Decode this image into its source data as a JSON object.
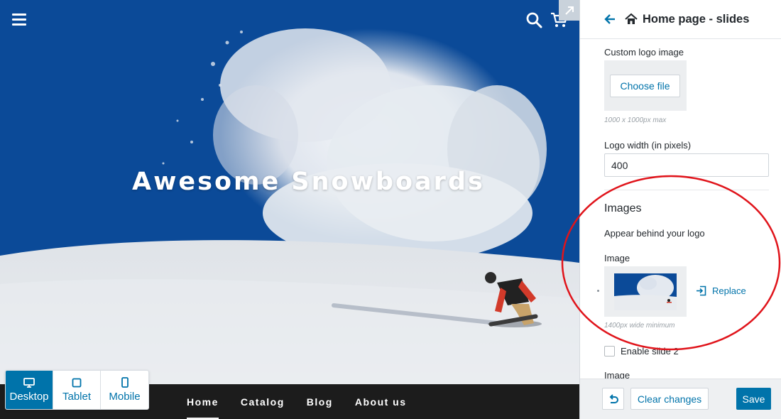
{
  "preview": {
    "hero_title": "Awesome Snowboards",
    "nav": [
      {
        "label": "Home",
        "active": true
      },
      {
        "label": "Catalog",
        "active": false
      },
      {
        "label": "Blog",
        "active": false
      },
      {
        "label": "About us",
        "active": false
      }
    ],
    "icons": {
      "menu": "hamburger-menu-icon",
      "search": "search-icon",
      "cart": "cart-icon",
      "expand": "expand-arrow-icon"
    }
  },
  "device_switcher": {
    "desktop": "Desktop",
    "tablet": "Tablet",
    "mobile": "Mobile",
    "active": "Desktop"
  },
  "panel": {
    "title": "Home page - slideshow",
    "logo_label": "Custom logo image",
    "choose_file": "Choose file",
    "logo_hint": "1000 x 1000px max",
    "logo_width_label": "Logo width (in pixels)",
    "logo_width_value": "400",
    "images_heading": "Images",
    "images_desc": "Appear behind your logo",
    "image_label": "Image",
    "replace": "Replace",
    "image_hint": "1400px wide minimum",
    "enable_slide_2": "Enable slide 2",
    "image_label_2": "Image"
  },
  "footer": {
    "clear_changes": "Clear changes",
    "save": "Save"
  },
  "colors": {
    "accent": "#0073aa",
    "sky": "#0b4a98",
    "annotation": "#e0141b"
  }
}
